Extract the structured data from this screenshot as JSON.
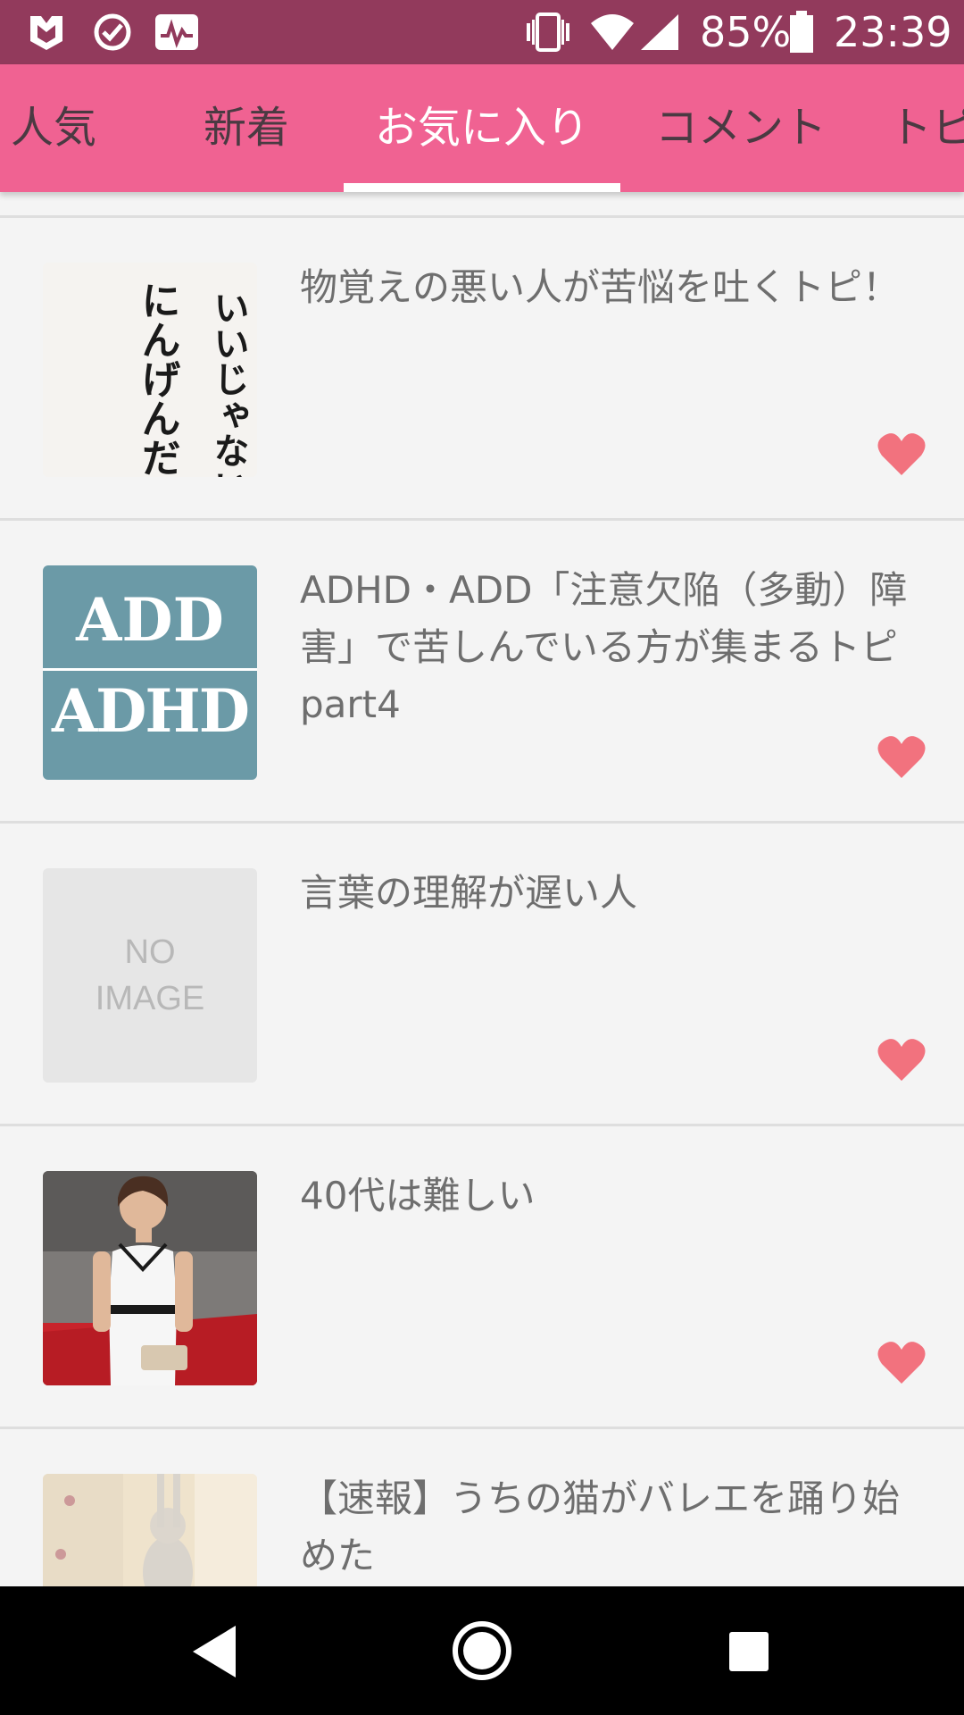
{
  "status_bar": {
    "battery_percent": "85%",
    "time": "23:39",
    "background": "#923a5c"
  },
  "tabs": [
    {
      "label": "人気",
      "active": false
    },
    {
      "label": "新着",
      "active": false
    },
    {
      "label": "お気に入り",
      "active": true
    },
    {
      "label": "コメント",
      "active": false
    },
    {
      "label": "トピ",
      "active": false
    }
  ],
  "accent_color": "#f06292",
  "heart_color": "#f2727e",
  "list": {
    "items": [
      {
        "title": "物覚えの悪い人が苦悩を吐くトピ！",
        "thumbnail": "calligraphy-image",
        "favorited": true
      },
      {
        "title": "ADHD・ADD「注意欠陥（多動）障害」で苦しんでいる方が集まるトピpart4",
        "thumbnail": "add-adhd-image",
        "thumb_line1": "ADD",
        "thumb_line2": "ADHD",
        "favorited": true
      },
      {
        "title": "言葉の理解が遅い人",
        "thumbnail": "no-image-placeholder",
        "thumb_line1": "NO",
        "thumb_line2": "IMAGE",
        "favorited": true
      },
      {
        "title": "40代は難しい",
        "thumbnail": "woman-photo",
        "favorited": true
      },
      {
        "title": "【速報】うちの猫がバレエを踊り始めた",
        "thumbnail": "cat-photo",
        "favorited": true
      }
    ]
  },
  "calligraphy_text": [
    "いいじゃないか",
    "にんげんだもの"
  ]
}
